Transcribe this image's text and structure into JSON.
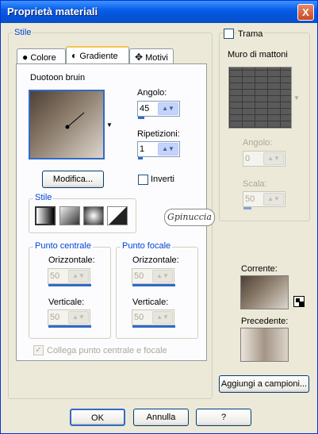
{
  "window": {
    "title": "Proprietà materiali",
    "close": "X"
  },
  "style_group": {
    "label": "Stile"
  },
  "tabs": [
    {
      "label": "Colore",
      "icon": "●"
    },
    {
      "label": "Gradiente",
      "icon": "◐"
    },
    {
      "label": "Motivi",
      "icon": "✥"
    }
  ],
  "gradient": {
    "name": "Duotoon bruin",
    "angle_label": "Angolo:",
    "angle_value": "45",
    "repeat_label": "Ripetizioni:",
    "repeat_value": "1",
    "edit_button": "Modifica...",
    "invert_label": "Inverti",
    "style_label": "Stile",
    "center_label": "Punto centrale",
    "focal_label": "Punto focale",
    "horiz_label": "Orizzontale:",
    "vert_label": "Verticale:",
    "center_h": "50",
    "center_v": "50",
    "focal_h": "50",
    "focal_v": "50",
    "link_label": "Collega punto centrale e focale"
  },
  "texture": {
    "label": "Trama",
    "name": "Muro di mattoni",
    "angle_label": "Angolo:",
    "angle_value": "0",
    "scale_label": "Scala:",
    "scale_value": "50"
  },
  "current": {
    "label": "Corrente:"
  },
  "previous": {
    "label": "Precedente:"
  },
  "add_swatch": "Aggiungi a campioni...",
  "buttons": {
    "ok": "OK",
    "cancel": "Annulla",
    "help": "?"
  },
  "watermark": "Gpinuccia",
  "colors": {
    "title_blue": "#0a5ee8",
    "group_label": "#0046d5",
    "gradient_dark": "#4e4036",
    "gradient_light": "#ddd6cd"
  }
}
